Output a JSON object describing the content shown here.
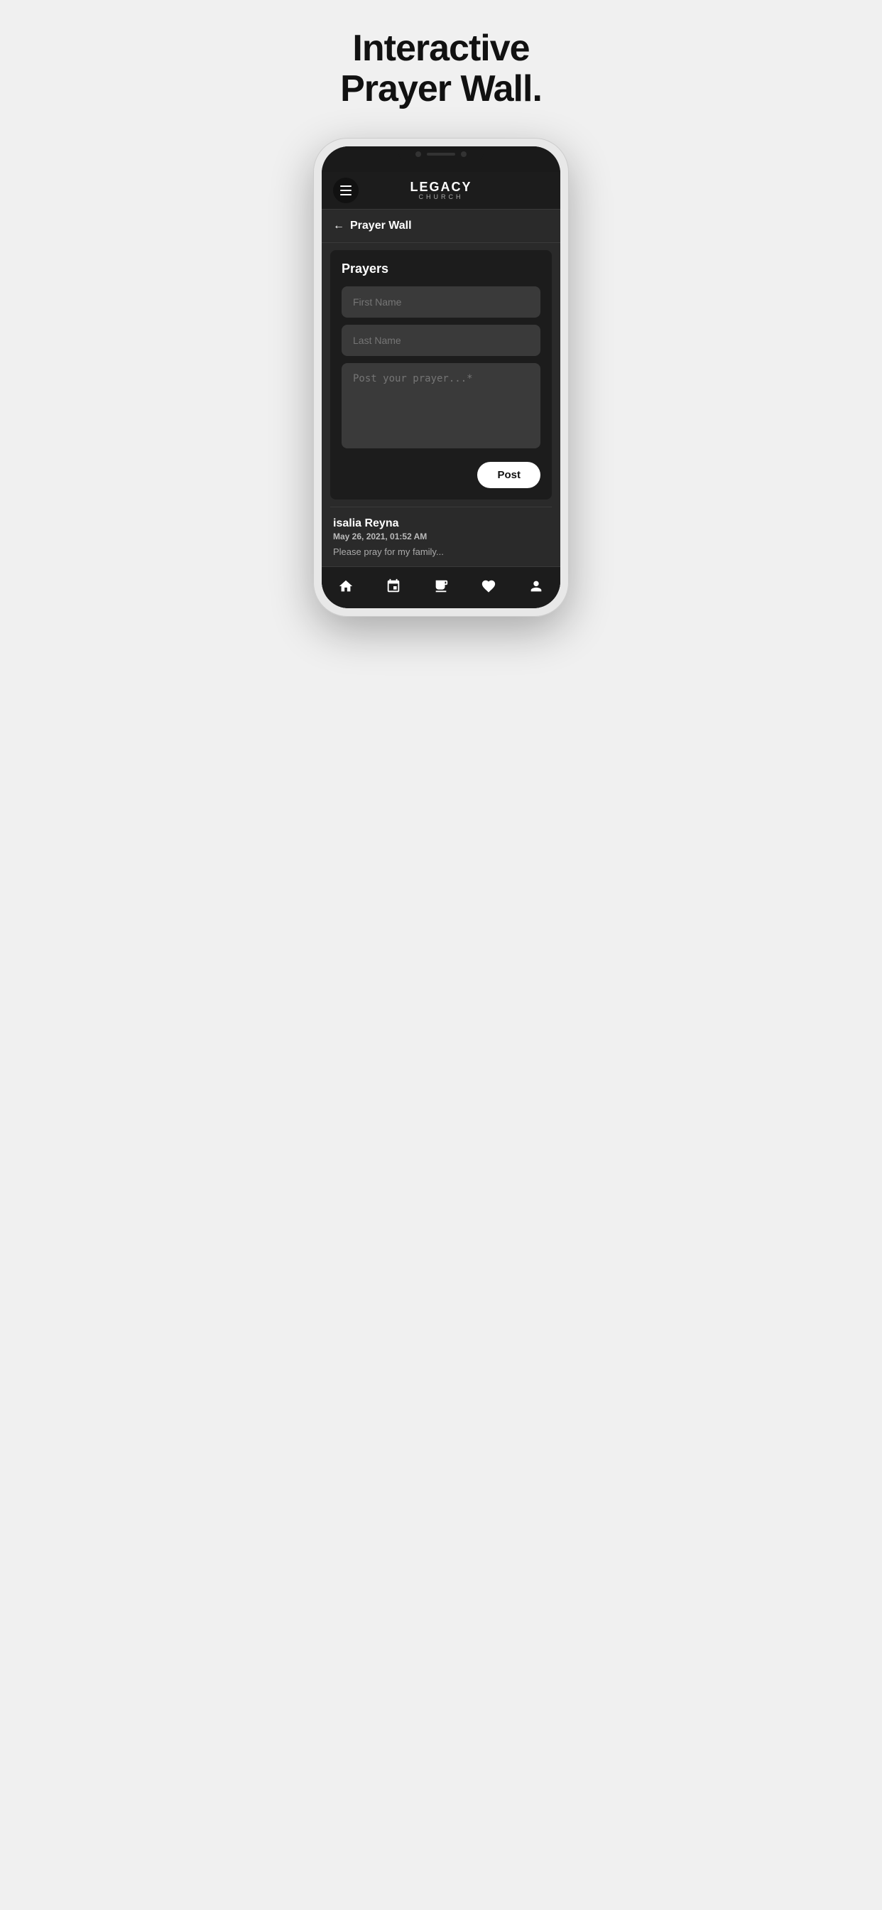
{
  "headline": {
    "line1": "Interactive",
    "line2": "Prayer Wall."
  },
  "app": {
    "logo_name": "LEGACY",
    "logo_sub": "CHURCH",
    "back_label": "Prayer Wall",
    "prayers_title": "Prayers",
    "first_name_placeholder": "First Name",
    "last_name_placeholder": "Last Name",
    "prayer_placeholder": "Post your prayer...*",
    "post_button_label": "Post",
    "prayer_post": {
      "name": "isalia Reyna",
      "date": "May 26, 2021, 01:52 AM",
      "text": "Please pray for my family..."
    }
  },
  "nav": {
    "items": [
      {
        "label": "Home",
        "icon": "home-icon"
      },
      {
        "label": "Calendar",
        "icon": "calendar-icon"
      },
      {
        "label": "News",
        "icon": "news-icon"
      },
      {
        "label": "Favorite",
        "icon": "heart-icon"
      },
      {
        "label": "Profile",
        "icon": "person-icon"
      }
    ]
  }
}
